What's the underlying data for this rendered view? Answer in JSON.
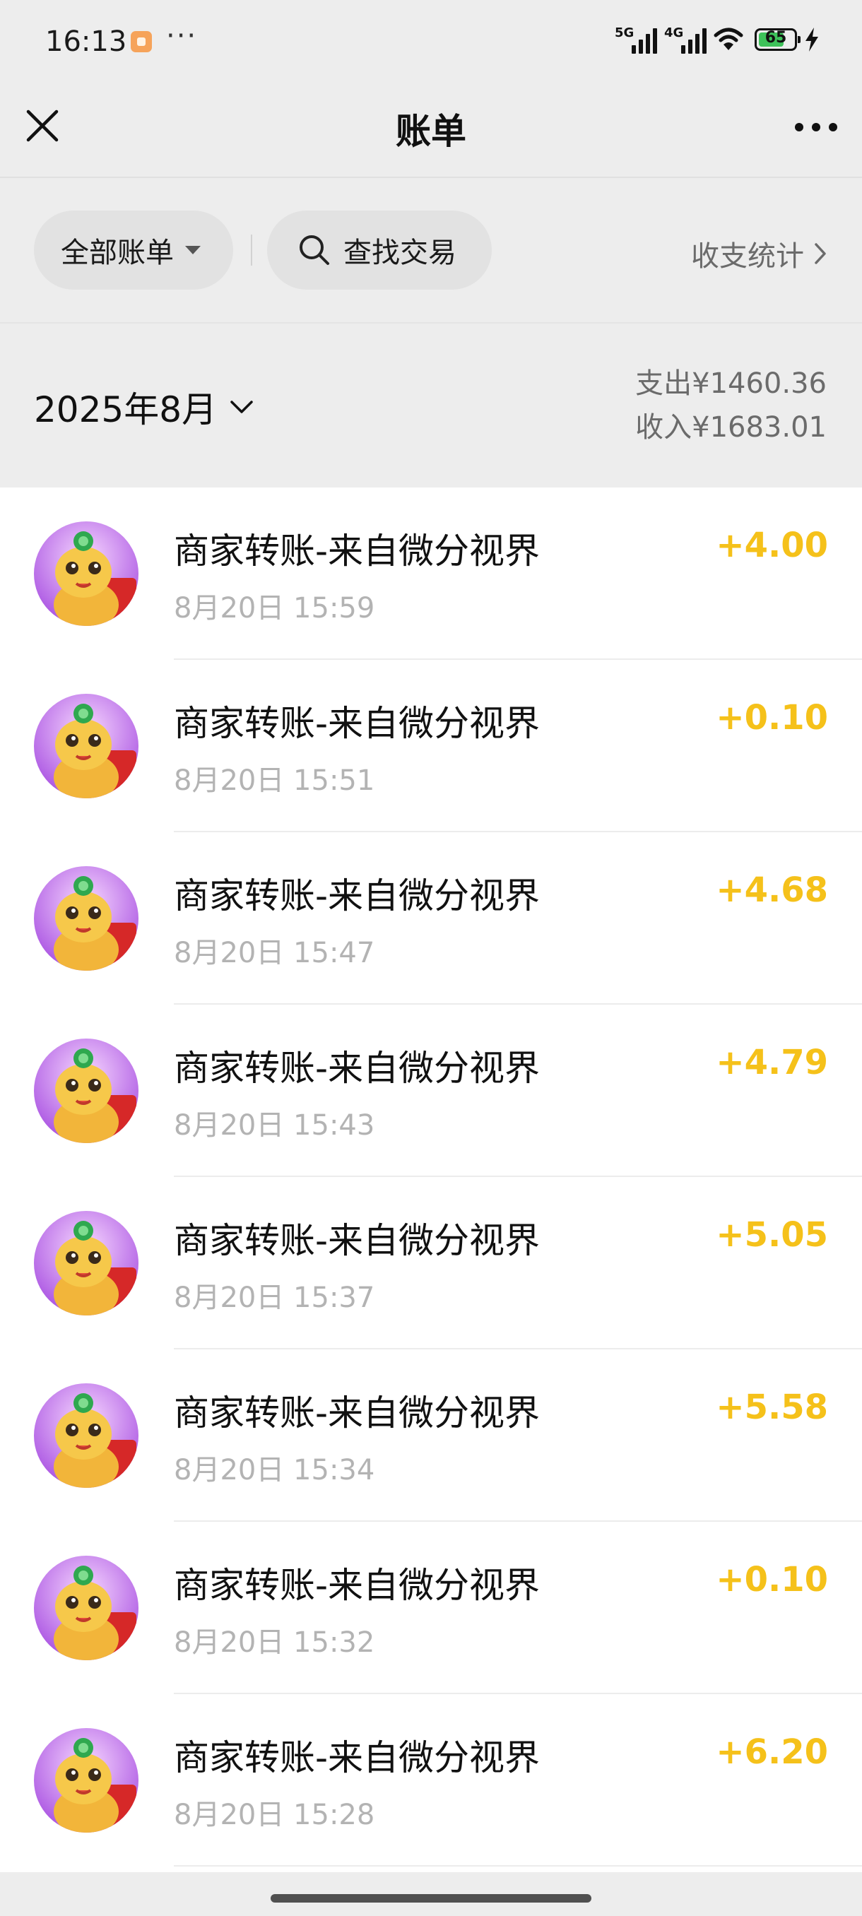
{
  "status_bar": {
    "time": "16:13",
    "dots": "···",
    "signal_1_label": "5G",
    "signal_2_label": "4G",
    "battery_level": "65"
  },
  "nav": {
    "title": "账单"
  },
  "filters": {
    "all_bills_label": "全部账单",
    "search_label": "查找交易",
    "stats_label": "收支统计"
  },
  "month": {
    "label": "2025年8月",
    "expense": "支出¥1460.36",
    "income": "收入¥1683.01"
  },
  "transactions": [
    {
      "title": "商家转账-来自微分视界",
      "time": "8月20日 15:59",
      "amount": "+4.00"
    },
    {
      "title": "商家转账-来自微分视界",
      "time": "8月20日 15:51",
      "amount": "+0.10"
    },
    {
      "title": "商家转账-来自微分视界",
      "time": "8月20日 15:47",
      "amount": "+4.68"
    },
    {
      "title": "商家转账-来自微分视界",
      "time": "8月20日 15:43",
      "amount": "+4.79"
    },
    {
      "title": "商家转账-来自微分视界",
      "time": "8月20日 15:37",
      "amount": "+5.05"
    },
    {
      "title": "商家转账-来自微分视界",
      "time": "8月20日 15:34",
      "amount": "+5.58"
    },
    {
      "title": "商家转账-来自微分视界",
      "time": "8月20日 15:32",
      "amount": "+0.10"
    },
    {
      "title": "商家转账-来自微分视界",
      "time": "8月20日 15:28",
      "amount": "+6.20"
    }
  ],
  "colors": {
    "income_amount": "#f5c11a",
    "page_background": "#ededed",
    "list_background": "#ffffff",
    "battery_fill": "#3ec25a"
  },
  "icons": {
    "close": "close-icon",
    "more": "more-dots-icon",
    "filter_caret": "caret-down-icon",
    "search": "search-icon",
    "stats_chevron": "chevron-right-icon",
    "month_chevron": "chevron-down-icon"
  }
}
